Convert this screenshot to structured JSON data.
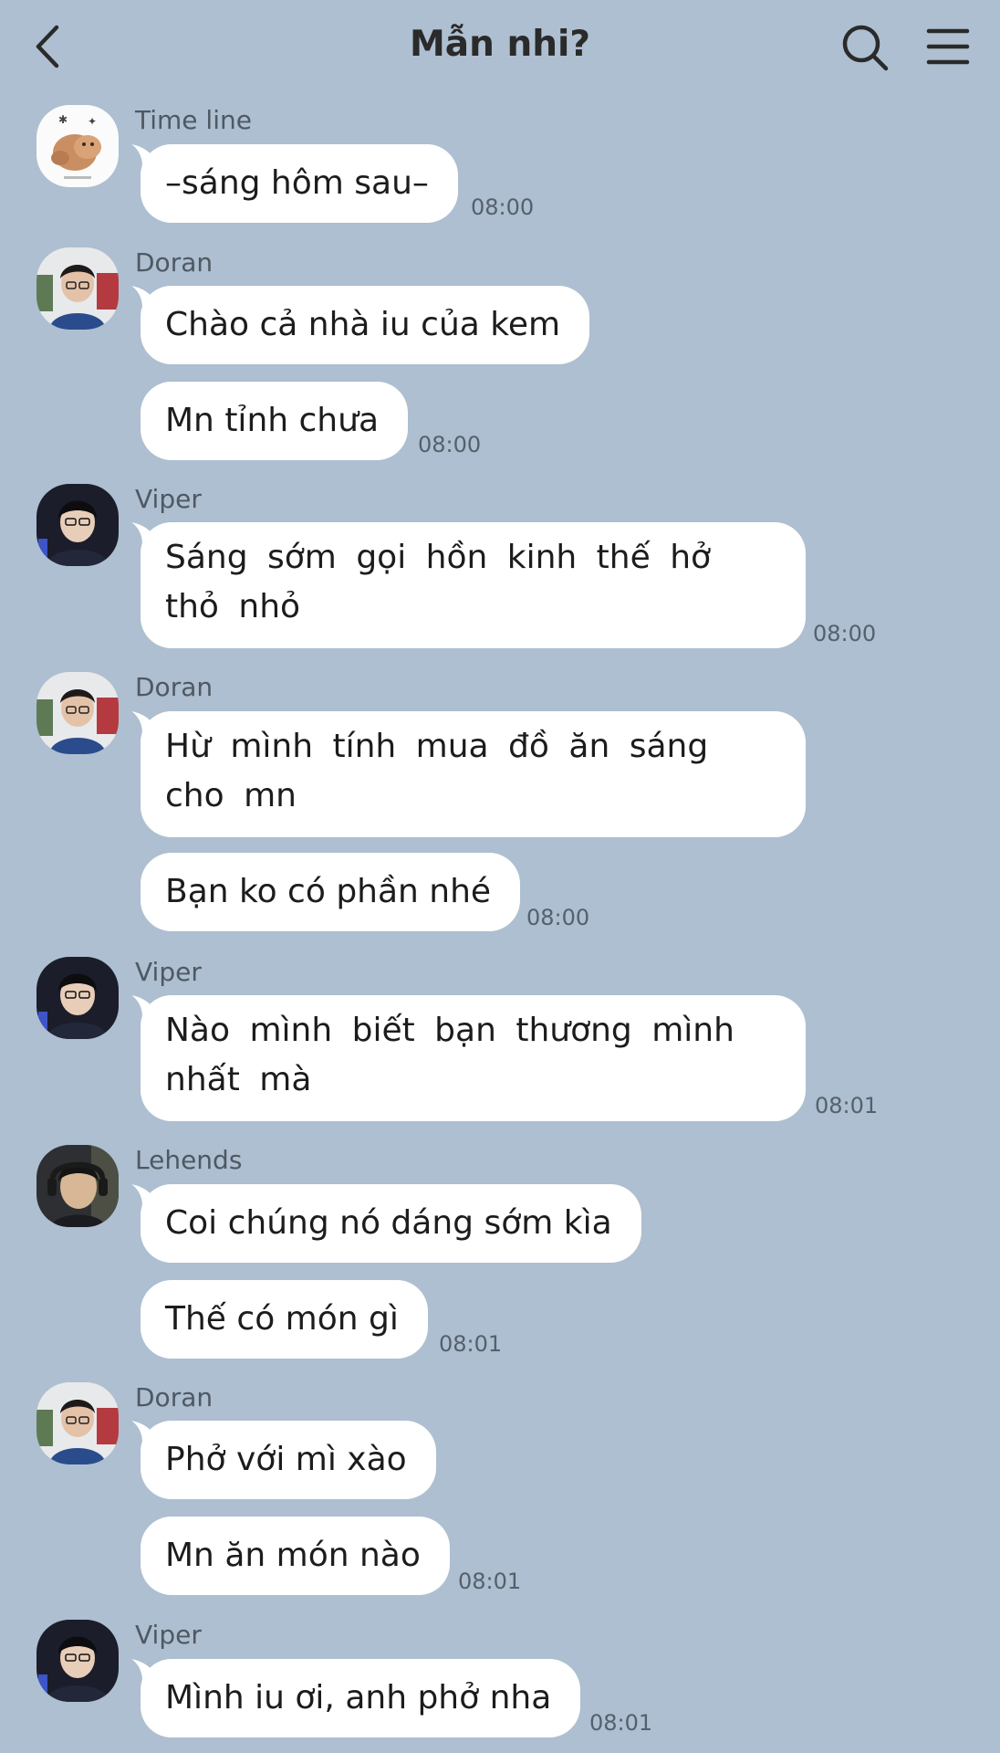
{
  "header": {
    "title": "Mẫn nhi?",
    "icons": {
      "back": "chevron-left-icon",
      "search": "search-icon",
      "menu": "hamburger-menu-icon"
    }
  },
  "messages": [
    {
      "sender": "Time line",
      "avatar": "sticker-avatar",
      "lines": [
        "–sáng hôm sau–"
      ],
      "time": "08:00"
    },
    {
      "sender": "Doran",
      "avatar": "doran-avatar",
      "lines": [
        "Chào cả nhà iu của kem",
        "Mn tỉnh chưa"
      ],
      "time": "08:00"
    },
    {
      "sender": "Viper",
      "avatar": "viper-avatar",
      "lines": [
        "Sáng sớm gọi hồn kinh thế hở thỏ nhỏ"
      ],
      "time": "08:00"
    },
    {
      "sender": "Doran",
      "avatar": "doran-avatar",
      "lines": [
        "Hừ mình tính mua đồ ăn sáng cho mn",
        "Bạn ko có phần nhé"
      ],
      "time": "08:00"
    },
    {
      "sender": "Viper",
      "avatar": "viper-avatar",
      "lines": [
        "Nào mình biết bạn thương mình nhất mà"
      ],
      "time": "08:01"
    },
    {
      "sender": "Lehends",
      "avatar": "lehends-avatar",
      "lines": [
        "Coi chúng nó dáng sớm kìa",
        "Thế có món gì"
      ],
      "time": "08:01"
    },
    {
      "sender": "Doran",
      "avatar": "doran-avatar",
      "lines": [
        "Phở với mì xào",
        "Mn ăn món nào"
      ],
      "time": "08:01"
    },
    {
      "sender": "Viper",
      "avatar": "viper-avatar",
      "lines": [
        "Mình iu ơi, anh phở nha"
      ],
      "time": "08:01"
    }
  ],
  "colors": {
    "background": "#adbfd0",
    "bubble": "#ffffff",
    "text": "#1c1c1c",
    "meta": "#55606c"
  }
}
